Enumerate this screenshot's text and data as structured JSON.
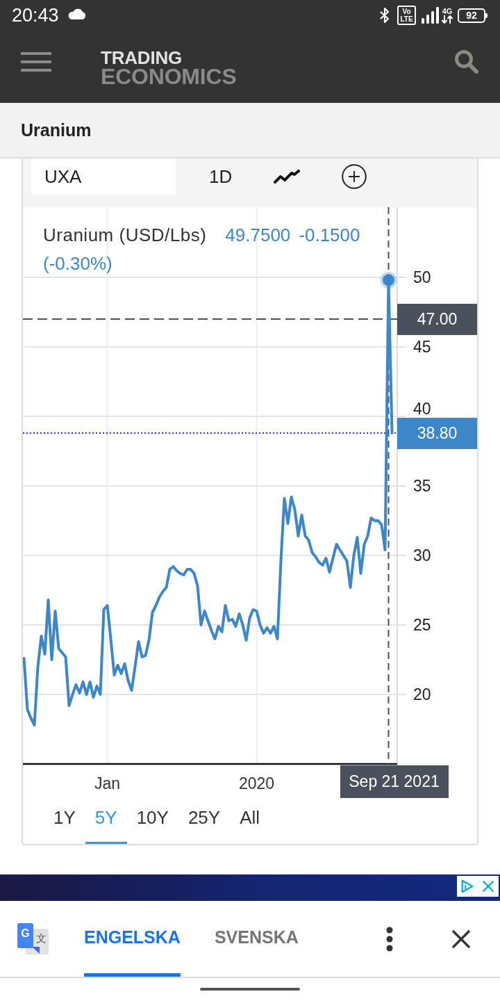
{
  "status_bar": {
    "time": "20:43",
    "volte_label": {
      "top": "Vo",
      "bottom": "LTE"
    },
    "network_type": "4G",
    "battery": "92"
  },
  "app_bar": {
    "logo_top": "TRADING",
    "logo_bottom": "ECONOMICS"
  },
  "page_title": "Uranium",
  "chart_card": {
    "toolbar": {
      "symbol": "UXA",
      "interval": "1D"
    },
    "legend": {
      "title": "Uranium (USD/Lbs)",
      "price": "49.7500",
      "change": "-0.1500",
      "change_percent": "(-0.30%)"
    },
    "chart_data": {
      "type": "line",
      "grid": true,
      "categories": [
        null,
        null,
        null,
        null,
        null,
        null,
        null,
        null,
        null,
        null,
        null,
        null,
        null,
        null,
        null,
        null,
        null,
        null,
        null,
        null,
        null,
        null,
        null,
        null,
        "Jan",
        null,
        null,
        null,
        null,
        null,
        null,
        null,
        null,
        null,
        null,
        null,
        null,
        null,
        null,
        null,
        null,
        null,
        null,
        null,
        null,
        null,
        null,
        null,
        null,
        null,
        null,
        null,
        null,
        null,
        null,
        null,
        null,
        null,
        null,
        null,
        null,
        null,
        null,
        null,
        null,
        null,
        null,
        "2020",
        null,
        null,
        null,
        null,
        null,
        null,
        null,
        null,
        null,
        null,
        null,
        null,
        null,
        null,
        null,
        null,
        null,
        null,
        null,
        null,
        null,
        null,
        null,
        null,
        null,
        null,
        null,
        null,
        null,
        null,
        null,
        null,
        null,
        null,
        null,
        null,
        null,
        "Sep 21 2021",
        null
      ],
      "series": [
        {
          "color": "#3d87c9",
          "values": [
            22.6,
            18.9,
            18.3,
            17.8,
            22.0,
            24.2,
            22.9,
            26.8,
            22.5,
            26.0,
            23.3,
            23.0,
            22.7,
            19.2,
            20.0,
            20.7,
            20.1,
            20.9,
            20.0,
            20.9,
            19.8,
            20.6,
            20.0,
            26.1,
            26.4,
            24.0,
            21.4,
            22.1,
            21.5,
            22.2,
            21.0,
            20.3,
            22.0,
            23.8,
            22.7,
            22.8,
            23.9,
            25.9,
            26.4,
            27.0,
            27.4,
            27.7,
            29.0,
            29.2,
            28.9,
            28.7,
            28.6,
            29.0,
            29.0,
            28.7,
            27.8,
            25.0,
            26.0,
            25.3,
            24.6,
            24.0,
            24.9,
            24.5,
            26.4,
            25.3,
            25.4,
            24.9,
            25.8,
            25.0,
            23.9,
            25.5,
            26.1,
            26.0,
            25.0,
            24.4,
            24.8,
            24.4,
            24.9,
            24.0,
            29.6,
            34.1,
            32.3,
            34.2,
            33.3,
            31.4,
            32.9,
            31.4,
            31.1,
            30.2,
            29.9,
            29.5,
            29.3,
            29.8,
            28.8,
            29.8,
            30.8,
            30.4,
            30.0,
            29.6,
            27.7,
            30.0,
            31.3,
            28.7,
            30.8,
            31.4,
            32.7,
            32.5,
            32.5,
            32.2,
            30.4,
            49.8,
            38.8
          ]
        }
      ],
      "ylim": [
        15,
        55
      ],
      "yticks": [
        20,
        25,
        30,
        35,
        40,
        45,
        50
      ],
      "ref_lines": [
        {
          "axis": "y",
          "value": 47,
          "label": "47.00",
          "color": "#4b515c"
        },
        {
          "axis": "y",
          "value": 38.8,
          "label": "38.80",
          "color": "#2233ee"
        },
        {
          "axis": "x",
          "value": "Sep 21 2021",
          "color": "#4b515c"
        }
      ]
    },
    "ranges": [
      {
        "label": "1Y",
        "selected": false
      },
      {
        "label": "5Y",
        "selected": true
      },
      {
        "label": "10Y",
        "selected": false
      },
      {
        "label": "25Y",
        "selected": false
      },
      {
        "label": "All",
        "selected": false
      }
    ]
  },
  "translate_bar": {
    "logo_text": {
      "front": "G",
      "back": "文"
    },
    "languages": [
      {
        "label": "ENGELSKA",
        "selected": true
      },
      {
        "label": "SVENSKA",
        "selected": false
      }
    ]
  }
}
